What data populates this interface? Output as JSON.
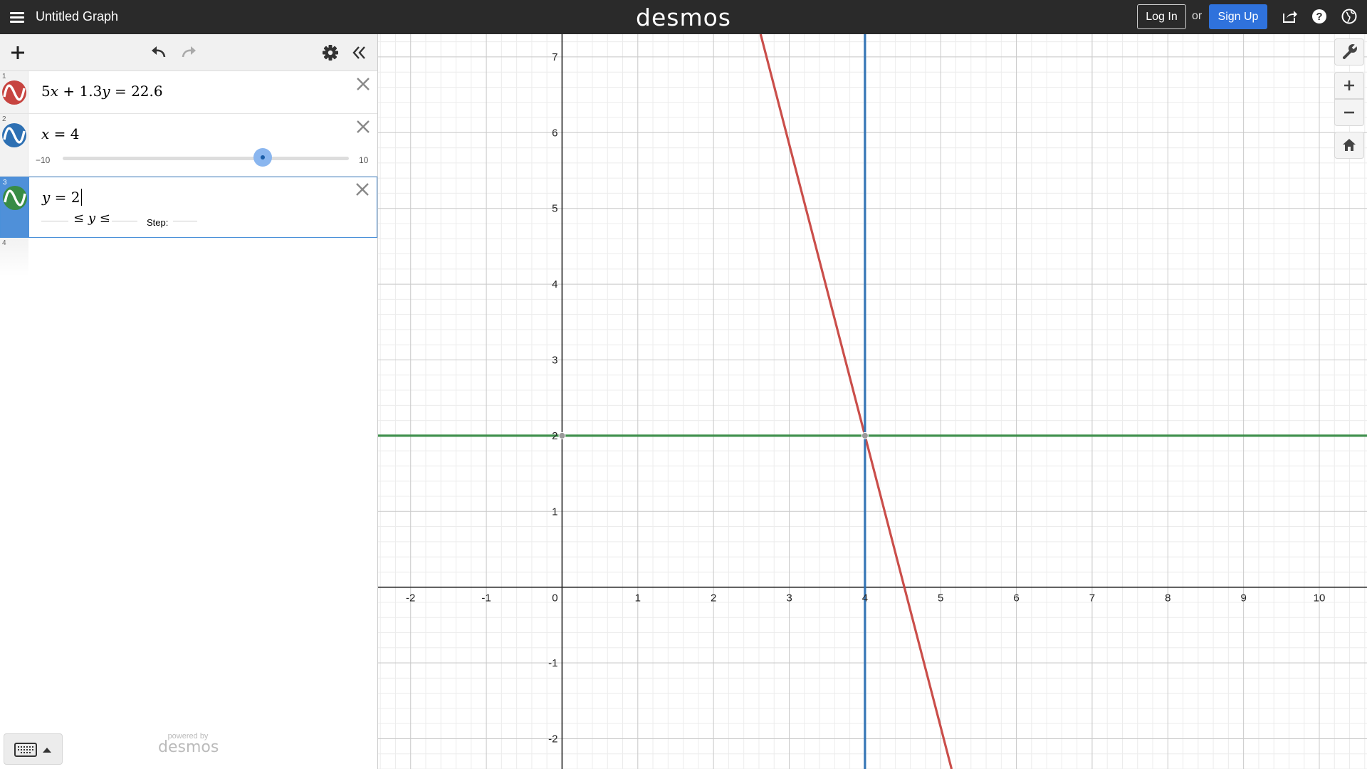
{
  "header": {
    "title": "Untitled Graph",
    "brand": "desmos",
    "login_label": "Log In",
    "or_label": "or",
    "signup_label": "Sign Up",
    "icons": [
      "menu-icon",
      "share-icon",
      "help-icon",
      "language-icon"
    ]
  },
  "toolbar": {
    "icons": [
      "add-icon",
      "undo-icon",
      "redo-icon",
      "settings-icon",
      "collapse-icon"
    ]
  },
  "expressions": [
    {
      "number": "1",
      "color": "#c74440",
      "parts": [
        "5",
        "x",
        " + 1.3",
        "y",
        " = 22.6"
      ]
    },
    {
      "number": "2",
      "color": "#2d70b3",
      "parts": [
        "",
        "x",
        " = 4"
      ],
      "slider": {
        "min_label": "−10",
        "max_label": "10",
        "min": -10,
        "max": 10,
        "value": 4
      }
    },
    {
      "number": "3",
      "color": "#388c46",
      "parts": [
        "",
        "y",
        " = 2"
      ],
      "range": {
        "ineq_left": "≤ ",
        "var": "y",
        "ineq_right": " ≤",
        "step_label": "Step:"
      }
    },
    {
      "number": "4"
    }
  ],
  "footer": {
    "powered_by": "powered by",
    "powered_brand": "desmos"
  },
  "graph": {
    "x_ticks": [
      "-2",
      "-1",
      "0",
      "1",
      "2",
      "3",
      "4",
      "5",
      "6",
      "7",
      "8",
      "9",
      "10"
    ],
    "y_ticks": [
      "-2",
      "-1",
      "1",
      "2",
      "3",
      "4",
      "5",
      "6",
      "7"
    ],
    "x_range": [
      -2.43,
      10.63
    ],
    "y_range": [
      -2.4,
      7.3
    ],
    "curves": [
      {
        "name": "line-1",
        "color": "#c74440",
        "a": 5,
        "b": 1.3,
        "c": 22.6
      },
      {
        "name": "line-2",
        "color": "#2d70b3",
        "vertical_x": 4
      },
      {
        "name": "line-3",
        "color": "#388c46",
        "horizontal_y": 2
      }
    ],
    "points": [
      {
        "x": 4,
        "y": 2
      },
      {
        "x": 0,
        "y": 2
      }
    ]
  },
  "graph_tools": {
    "icons": [
      "wrench-icon",
      "zoom-in-icon",
      "zoom-out-icon",
      "home-icon"
    ]
  }
}
